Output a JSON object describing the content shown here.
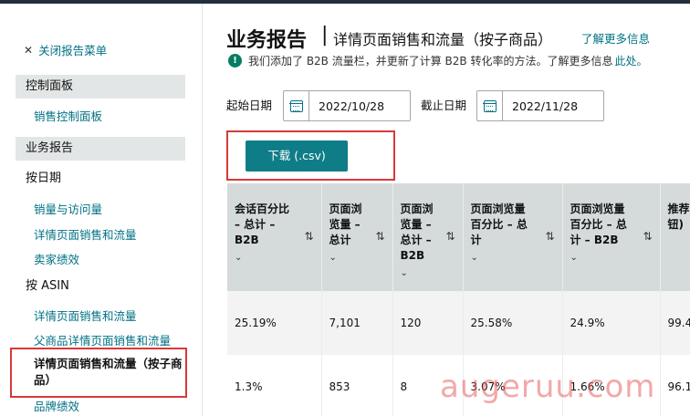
{
  "sidebar": {
    "close_menu": "关闭报告菜单",
    "section_dashboard": "控制面板",
    "link_sales_dashboard": "销售控制面板",
    "section_business_reports": "业务报告",
    "label_by_date": "按日期",
    "link_sales_traffic": "销量与访问量",
    "link_detail_page_sales": "详情页面销售和流量",
    "link_seller_performance": "卖家绩效",
    "label_by_asin": "按 ASIN",
    "link_asin_detail_page": "详情页面销售和流量",
    "link_parent_detail_page": "父商品详情页面销售和流量",
    "active_item": "详情页面销售和流量（按子商品）",
    "link_brand_performance": "品牌绩效"
  },
  "header": {
    "title": "业务报告",
    "separator": "|",
    "subtitle": "详情页面销售和流量（按子商品）",
    "learn_more": "了解更多信息"
  },
  "notice": {
    "text": "我们添加了 B2B 流量栏，并更新了计算 B2B 转化率的方法。了解更多信息",
    "link": "此处。"
  },
  "date_range": {
    "start_label": "起始日期",
    "start_value": "2022/10/28",
    "end_label": "截止日期",
    "end_value": "2022/11/28"
  },
  "download": {
    "label": "下载 (.csv)"
  },
  "table": {
    "columns": [
      {
        "line1": "会话百分比",
        "line2": "– 总计 –",
        "line3": "B2B"
      },
      {
        "line1": "页面浏",
        "line2": "览量 –",
        "line3": "总计"
      },
      {
        "line1": "页面浏",
        "line2": "览量 –",
        "line3": "总计 –",
        "line4": "B2B"
      },
      {
        "line1": "页面浏览量",
        "line2": "百分比 – 总",
        "line3": "计"
      },
      {
        "line1": "页面浏览量",
        "line2": "百分比 – 总",
        "line3": "计 – B2B"
      },
      {
        "line1": "推荐",
        "line2": "钮)"
      }
    ],
    "rows": [
      [
        "25.19%",
        "7,101",
        "120",
        "25.58%",
        "24.9%",
        "99.4"
      ],
      [
        "1.3%",
        "853",
        "8",
        "3.07%",
        "1.66%",
        "96.1"
      ]
    ]
  },
  "watermark": "augeruu.com",
  "colors": {
    "accent_teal": "#0f7d88",
    "link": "#007185",
    "highlight_red": "#d93838",
    "header_gray": "#d5dbdb",
    "success_green": "#067d62"
  }
}
